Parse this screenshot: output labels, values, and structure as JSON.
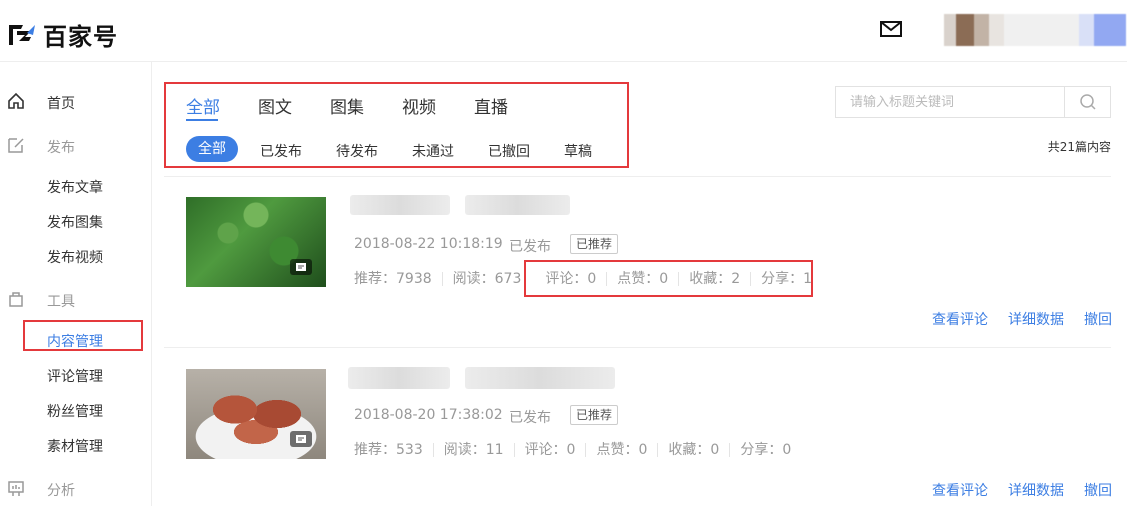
{
  "header": {
    "logo_text": "百家号",
    "mail_icon": "mail-icon"
  },
  "sidebar": {
    "home": "首页",
    "publish_group": "发布",
    "publish_article": "发布文章",
    "publish_gallery": "发布图集",
    "publish_video": "发布视频",
    "tools_group": "工具",
    "content_manage": "内容管理",
    "comment_manage": "评论管理",
    "fans_manage": "粉丝管理",
    "material_manage": "素材管理",
    "analysis_group": "分析"
  },
  "tabs": [
    "全部",
    "图文",
    "图集",
    "视频",
    "直播"
  ],
  "subtabs": [
    "全部",
    "已发布",
    "待发布",
    "未通过",
    "已撤回",
    "草稿"
  ],
  "search": {
    "placeholder": "请输入标题关键词"
  },
  "total": "共21篇内容",
  "articles": [
    {
      "datetime": "2018-08-22 10:18:19",
      "status": "已发布",
      "badge": "已推荐",
      "stats_a": [
        "推荐：7938",
        "阅读：673"
      ],
      "stats_b": [
        "评论：0",
        "点赞：0",
        "收藏：2",
        "分享：1"
      ],
      "actions": [
        "查看评论",
        "详细数据",
        "撤回"
      ]
    },
    {
      "datetime": "2018-08-20 17:38:02",
      "status": "已发布",
      "badge": "已推荐",
      "stats": [
        "推荐：533",
        "阅读：11",
        "评论：0",
        "点赞：0",
        "收藏：0",
        "分享：0"
      ],
      "actions": [
        "查看评论",
        "详细数据",
        "撤回"
      ]
    }
  ],
  "colors": {
    "accent": "#3c7ee3",
    "highlight": "#e4393c"
  }
}
